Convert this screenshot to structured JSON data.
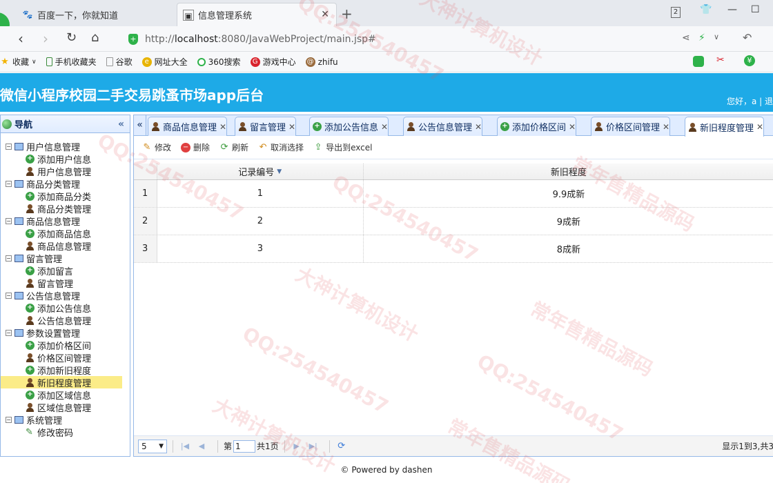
{
  "browser": {
    "tab_inactive": "百度一下，你就知道",
    "tab_active": "信息管理系统",
    "url_prefix": "http://",
    "url_host": "localhost",
    "url_rest": ":8080/JavaWebProject/main.jsp#",
    "tab_count": "2",
    "bookmarks": [
      {
        "label": "收藏",
        "icon": "star-icon"
      },
      {
        "label": "手机收藏夹",
        "icon": "phone-icon"
      },
      {
        "label": "谷歌",
        "icon": "page-icon"
      },
      {
        "label": "网址大全",
        "icon": "globe-icon"
      },
      {
        "label": "360搜索",
        "icon": "search-icon"
      },
      {
        "label": "游戏中心",
        "icon": "game-icon"
      },
      {
        "label": "zhifu",
        "icon": "pay-icon"
      }
    ]
  },
  "app": {
    "title": "微信小程序校园二手交易跳蚤市场app后台",
    "greeting": "您好，a | 退"
  },
  "nav": {
    "title": "导航",
    "groups": [
      {
        "label": "用户信息管理",
        "items": [
          "添加用户信息",
          "用户信息管理"
        ]
      },
      {
        "label": "商品分类管理",
        "items": [
          "添加商品分类",
          "商品分类管理"
        ]
      },
      {
        "label": "商品信息管理",
        "items": [
          "添加商品信息",
          "商品信息管理"
        ]
      },
      {
        "label": "留言管理",
        "items": [
          "添加留言",
          "留言管理"
        ]
      },
      {
        "label": "公告信息管理",
        "items": [
          "添加公告信息",
          "公告信息管理"
        ]
      },
      {
        "label": "参数设置管理",
        "items": [
          "添加价格区间",
          "价格区间管理",
          "添加新旧程度",
          "新旧程度管理",
          "添加区域信息",
          "区域信息管理"
        ]
      },
      {
        "label": "系统管理",
        "items": [
          "修改密码"
        ]
      }
    ]
  },
  "tabs": [
    {
      "label": "商品信息管理"
    },
    {
      "label": "留言管理"
    },
    {
      "label": "添加公告信息"
    },
    {
      "label": "公告信息管理"
    },
    {
      "label": "添加价格区间"
    },
    {
      "label": "价格区间管理"
    },
    {
      "label": "新旧程度管理"
    }
  ],
  "toolbar": {
    "edit": "修改",
    "delete": "删除",
    "refresh": "刷新",
    "cancel_select": "取消选择",
    "export": "导出到excel"
  },
  "grid": {
    "columns": [
      "记录编号",
      "新旧程度"
    ],
    "rows": [
      {
        "rn": "1",
        "id": "1",
        "cond": "9.9成新"
      },
      {
        "rn": "2",
        "id": "2",
        "cond": "9成新"
      },
      {
        "rn": "3",
        "id": "3",
        "cond": "8成新"
      }
    ]
  },
  "pager": {
    "page_size": "5",
    "page_label": "第",
    "page_value": "1",
    "total_pages": "共1页",
    "info": "显示1到3,共3"
  },
  "footer": "© Powered by dashen",
  "watermarks": [
    "QQ:254540457",
    "大神计算机设计",
    "常年售精品源码"
  ]
}
